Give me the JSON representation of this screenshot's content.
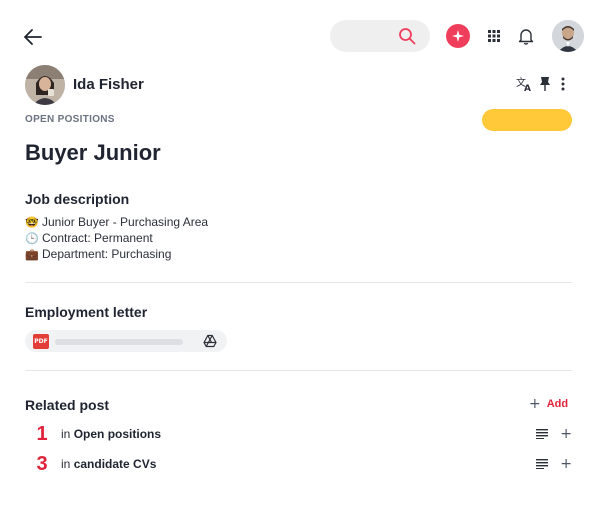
{
  "header": {
    "search": {
      "placeholder": ""
    },
    "icons": [
      "arrow-left-icon",
      "search-icon",
      "sparkle-icon",
      "apps-grid-icon",
      "bell-icon",
      "avatar"
    ]
  },
  "post": {
    "author": "Ida Fisher",
    "category": "OPEN POSITIONS",
    "status": "",
    "title": "Buyer Junior",
    "description": {
      "heading": "Job description",
      "lines": [
        {
          "emoji": "🤓",
          "text": "Junior Buyer - Purchasing Area"
        },
        {
          "emoji": "🕒",
          "text": "Contract: Permanent"
        },
        {
          "emoji": "💼",
          "text": "Department: Purchasing"
        }
      ]
    },
    "employment": {
      "heading": "Employment letter",
      "attachment": {
        "type_badge": "PDF",
        "file_name": ""
      }
    },
    "related": {
      "heading": "Related post",
      "add_label": "Add",
      "items": [
        {
          "count": "1",
          "prefix": "in",
          "target": "Open positions"
        },
        {
          "count": "3",
          "prefix": "in",
          "target": "candidate CVs"
        }
      ]
    }
  },
  "colors": {
    "accent_red": "#e0243c",
    "ai_button": "#ef3e5c",
    "status_yellow": "#ffc93a",
    "text_dark": "#1f2430",
    "muted": "#6b7280"
  }
}
